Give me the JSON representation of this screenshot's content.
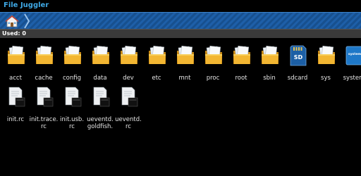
{
  "app": {
    "title": "File Juggler"
  },
  "status": {
    "used": "Used: 0"
  },
  "folders": [
    {
      "label": "acct",
      "icon": "folder-icon"
    },
    {
      "label": "cache",
      "icon": "folder-icon"
    },
    {
      "label": "config",
      "icon": "folder-icon"
    },
    {
      "label": "data",
      "icon": "folder-icon"
    },
    {
      "label": "dev",
      "icon": "folder-icon"
    },
    {
      "label": "etc",
      "icon": "folder-icon"
    },
    {
      "label": "mnt",
      "icon": "folder-icon"
    },
    {
      "label": "proc",
      "icon": "folder-icon"
    },
    {
      "label": "root",
      "icon": "folder-icon"
    },
    {
      "label": "sbin",
      "icon": "folder-icon"
    },
    {
      "label": "sdcard",
      "icon": "sdcard-icon",
      "badge": "SD"
    },
    {
      "label": "sys",
      "icon": "folder-icon"
    },
    {
      "label": "system",
      "icon": "system-icon",
      "badge": "system"
    }
  ],
  "files": [
    {
      "label": "init.rc",
      "icon": "file-icon"
    },
    {
      "label": "init.trace.\nrc",
      "icon": "file-icon"
    },
    {
      "label": "init.usb.\nrc",
      "icon": "file-icon"
    },
    {
      "label": "ueventd.\ngoldfish.",
      "icon": "file-icon"
    },
    {
      "label": "ueventd.\nrc",
      "icon": "file-icon"
    }
  ]
}
